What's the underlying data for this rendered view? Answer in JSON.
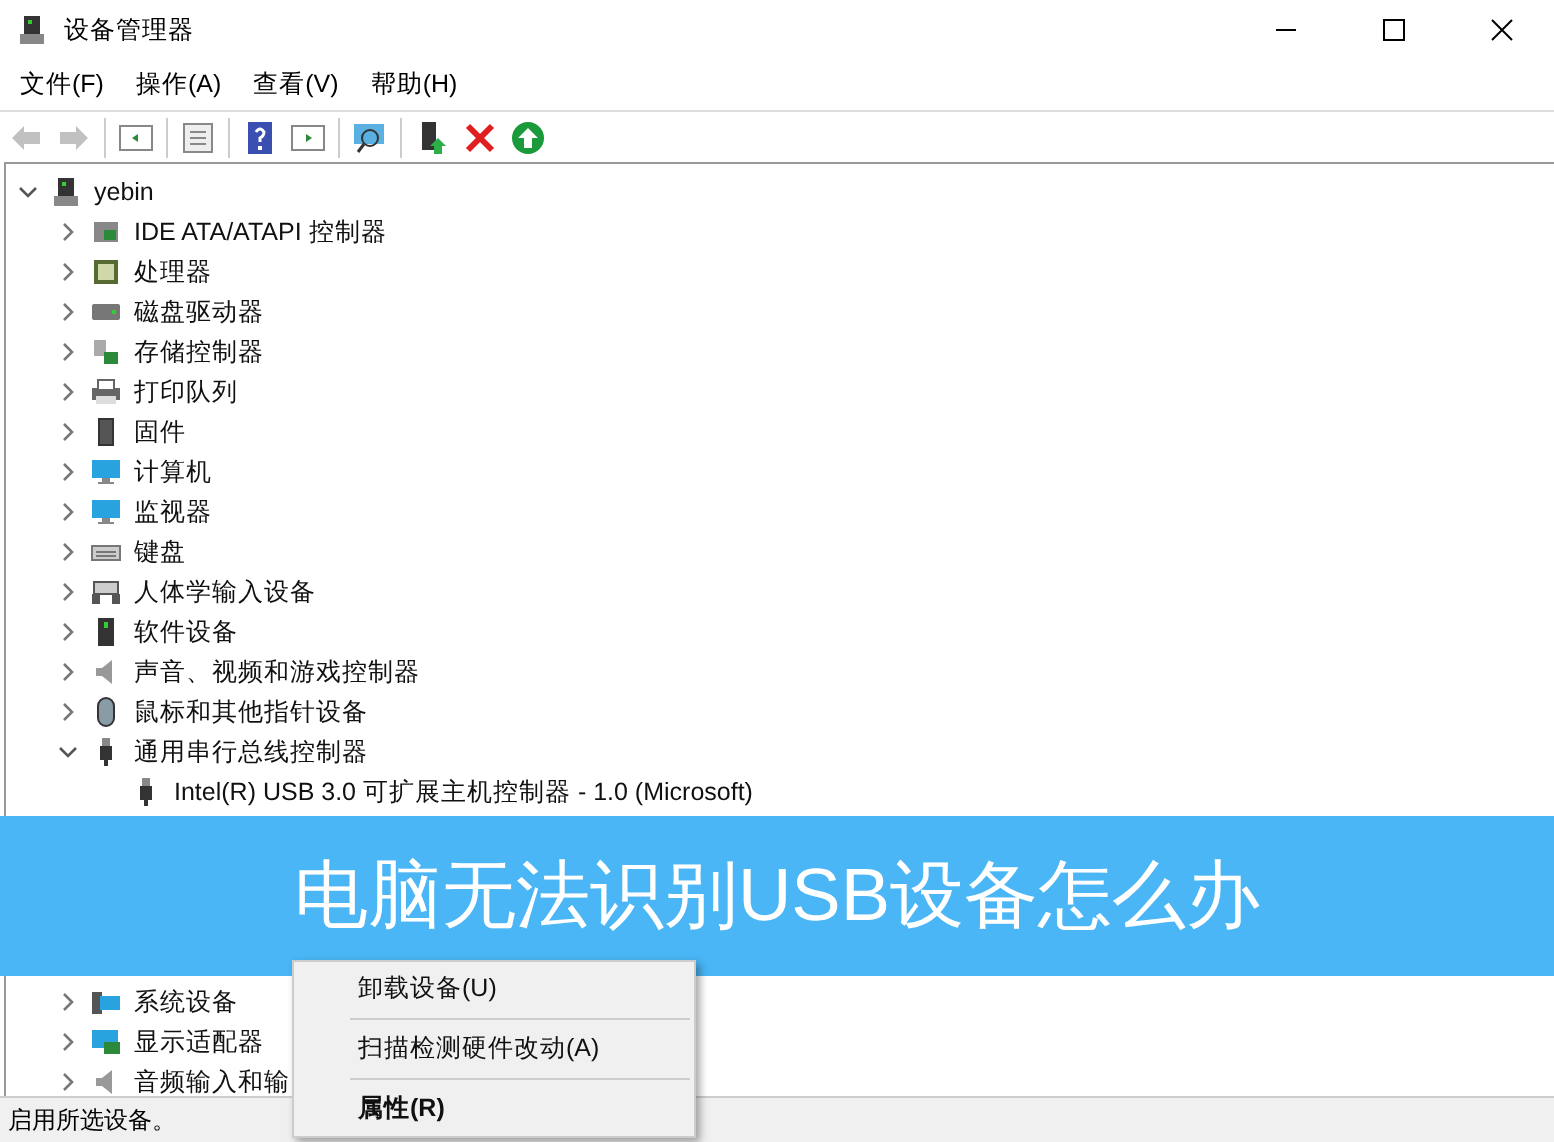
{
  "window": {
    "title": "设备管理器"
  },
  "menu": [
    "文件(F)",
    "操作(A)",
    "查看(V)",
    "帮助(H)"
  ],
  "tree": [
    {
      "label": "yebin",
      "expanded": true,
      "children": [
        {
          "label": "IDE ATA/ATAPI 控制器",
          "expanded": false
        },
        {
          "label": "处理器",
          "expanded": false
        },
        {
          "label": "磁盘驱动器",
          "expanded": false
        },
        {
          "label": "存储控制器",
          "expanded": false
        },
        {
          "label": "打印队列",
          "expanded": false
        },
        {
          "label": "固件",
          "expanded": false
        },
        {
          "label": "计算机",
          "expanded": false
        },
        {
          "label": "监视器",
          "expanded": false
        },
        {
          "label": "键盘",
          "expanded": false
        },
        {
          "label": "人体学输入设备",
          "expanded": false
        },
        {
          "label": "软件设备",
          "expanded": false
        },
        {
          "label": "声音、视频和游戏控制器",
          "expanded": false
        },
        {
          "label": "鼠标和其他指针设备",
          "expanded": false
        },
        {
          "label": "通用串行总线控制器",
          "expanded": true,
          "children": [
            {
              "label": "Intel(R) USB 3.0 可扩展主机控制器 - 1.0 (Microsoft)"
            }
          ]
        },
        {
          "label": "系统设备",
          "expanded": false
        },
        {
          "label": "显示适配器",
          "expanded": false
        },
        {
          "label": "音频输入和输",
          "expanded": false
        }
      ]
    }
  ],
  "context_menu": [
    {
      "label": "卸载设备(U)",
      "kind": "item",
      "disabled": false
    },
    {
      "kind": "separator"
    },
    {
      "label": "扫描检测硬件改动(A)",
      "kind": "item",
      "disabled": false
    },
    {
      "kind": "separator"
    },
    {
      "label": "属性(R)",
      "kind": "bold",
      "disabled": false
    }
  ],
  "status_bar": "启用所选设备。",
  "banner": {
    "title": "电脑无法识别USB设备怎么办"
  }
}
